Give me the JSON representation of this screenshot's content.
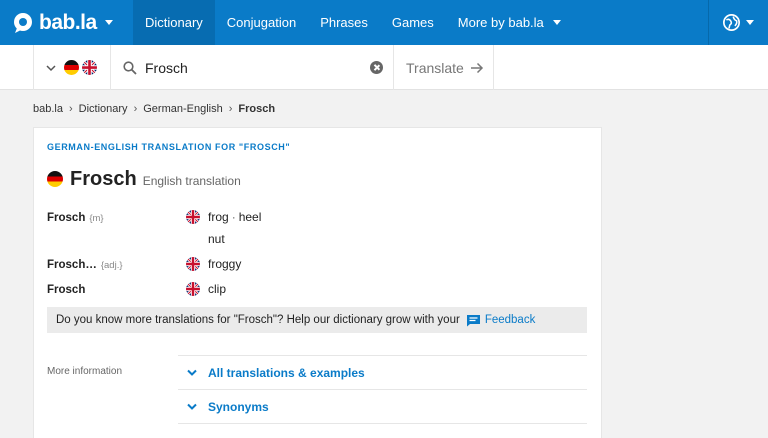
{
  "nav": {
    "logo": "bab.la",
    "items": [
      {
        "label": "Dictionary"
      },
      {
        "label": "Conjugation"
      },
      {
        "label": "Phrases"
      },
      {
        "label": "Games"
      },
      {
        "label": "More by bab.la"
      }
    ]
  },
  "search": {
    "value": "Frosch",
    "translate_label": "Translate"
  },
  "breadcrumb": [
    "bab.la",
    "Dictionary",
    "German-English",
    "Frosch"
  ],
  "card": {
    "heading": "GERMAN-ENGLISH TRANSLATION FOR \"FROSCH\"",
    "title": "Frosch",
    "subtitle": "English translation",
    "entries": [
      {
        "headword": "Frosch",
        "pos": "{m}",
        "translations": [
          "frog",
          "heel"
        ],
        "extra": "nut"
      },
      {
        "headword": "Frosch…",
        "pos": "{adj.}",
        "translations": [
          "froggy"
        ]
      },
      {
        "headword": "Frosch",
        "pos": "",
        "translations": [
          "clip"
        ]
      }
    ],
    "feedback_text": "Do you know more translations for \"Frosch\"? Help our dictionary grow with your",
    "feedback_link": "Feedback",
    "more_info_label": "More information",
    "expanders": [
      "All translations & examples",
      "Synonyms"
    ]
  },
  "colors": {
    "brand": "#0a7bc8",
    "background": "#f2f2f2"
  },
  "icons": [
    "logo-bubble-icon",
    "chevron-down-icon",
    "flag-germany-icon",
    "flag-uk-icon",
    "search-icon",
    "clear-icon",
    "arrow-right-icon",
    "globe-icon",
    "feedback-chat-icon"
  ]
}
